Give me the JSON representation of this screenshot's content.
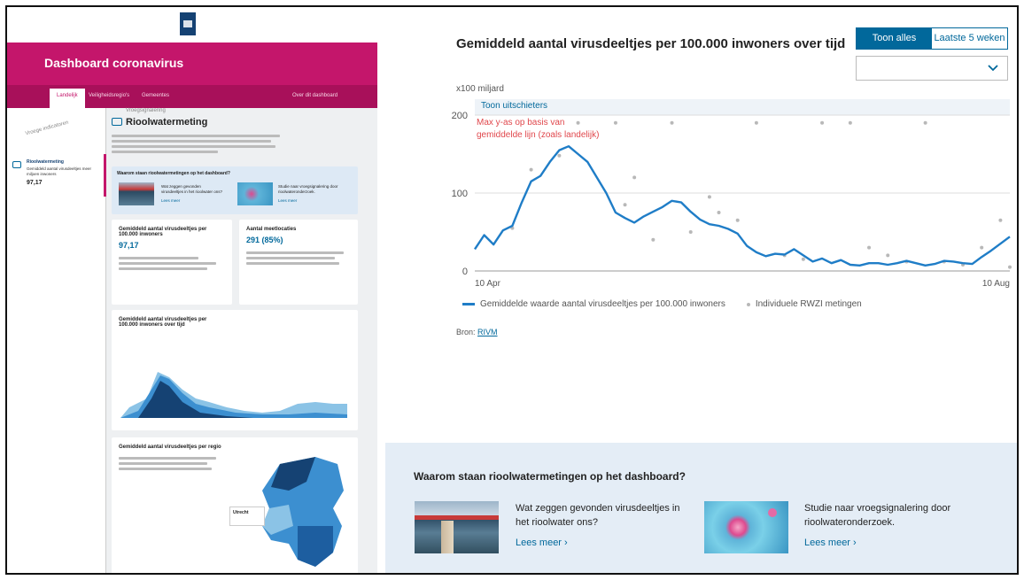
{
  "mini_dashboard": {
    "header_title": "Dashboard coronavirus",
    "nav": [
      "Landelijk",
      "Veiligheidsregio's",
      "Gemeentes",
      "Over dit dashboard"
    ],
    "sidebar_rotated_label": "Vroege indicatoren",
    "sidebar_item_title": "Rioolwatermeting",
    "sidebar_item_desc": "Gemiddeld aantal virusdeeltjes\nmeer miljoen inwoners",
    "sidebar_item_value": "97,17",
    "page_category": "Vroegsignalering",
    "page_title": "Rioolwatermeting",
    "cards": {
      "waarom": "Waarom staan rioolwatermetingen op het dashboard?",
      "waarom_q1": "Wat zeggen gevonden virusdeeltjes in het rioolwater ons?",
      "waarom_q2": "Studie naar vroegsignalering door rioolwateronderzoek.",
      "lees_meer": "Lees meer",
      "avg_title": "Gemiddeld aantal virusdeeltjes per 100.000 inwoners",
      "avg_value": "97,17",
      "loc_title": "Aantal meetlocaties",
      "loc_value": "291 (85%)",
      "chart_title": "Gemiddeld aantal virusdeeltjes per 100.000 inwoners over tijd",
      "map_title": "Gemiddeld aantal virusdeeltjes per regio",
      "map_tooltip_region": "Utrecht"
    }
  },
  "big_chart": {
    "title": "Gemiddeld aantal virusdeeltjes per 100.000 inwoners over tijd",
    "toggle_options": [
      "Toon alles",
      "Laatste 5 weken"
    ],
    "toggle_active": 0,
    "unit_label": "x100 miljard",
    "show_outliers_label": "Toon uitschieters",
    "note": "Max y-as op basis van gemiddelde lijn (zoals landelijk)",
    "source_label": "Bron:",
    "source_link": "RIVM",
    "legend": [
      "Gemiddelde waarde aantal virusdeeltjes per 100.000 inwoners",
      "Individuele RWZI metingen"
    ]
  },
  "chart_data": {
    "type": "line",
    "xlabel": "",
    "ylabel": "x100 miljard",
    "ylim": [
      0,
      200
    ],
    "yticks": [
      0,
      100,
      200
    ],
    "x_tick_labels": [
      "10 Apr",
      "10 Aug"
    ],
    "grid": true,
    "legend_position": "bottom",
    "colors": {
      "line": "#1f7dc7",
      "dots": "#b8b8b8"
    },
    "series": [
      {
        "name": "Gemiddelde waarde aantal virusdeeltjes per 100.000 inwoners",
        "values": [
          28,
          46,
          34,
          52,
          58,
          88,
          115,
          122,
          140,
          155,
          160,
          150,
          140,
          120,
          100,
          75,
          68,
          62,
          70,
          76,
          82,
          90,
          88,
          76,
          66,
          60,
          58,
          54,
          48,
          32,
          24,
          19,
          22,
          21,
          28,
          20,
          12,
          16,
          10,
          14,
          8,
          7,
          10,
          10,
          8,
          10,
          13,
          10,
          7,
          9,
          13,
          12,
          10,
          9,
          18,
          26,
          35,
          44
        ]
      },
      {
        "name": "Individuele RWZI metingen",
        "points": [
          [
            4,
            55
          ],
          [
            6,
            130
          ],
          [
            9,
            148
          ],
          [
            11,
            190
          ],
          [
            15,
            190
          ],
          [
            16,
            85
          ],
          [
            17,
            120
          ],
          [
            19,
            40
          ],
          [
            21,
            190
          ],
          [
            23,
            50
          ],
          [
            25,
            95
          ],
          [
            26,
            75
          ],
          [
            28,
            65
          ],
          [
            30,
            190
          ],
          [
            33,
            20
          ],
          [
            35,
            15
          ],
          [
            37,
            190
          ],
          [
            40,
            190
          ],
          [
            42,
            30
          ],
          [
            44,
            20
          ],
          [
            46,
            12
          ],
          [
            48,
            190
          ],
          [
            50,
            12
          ],
          [
            52,
            8
          ],
          [
            54,
            30
          ],
          [
            56,
            65
          ],
          [
            57,
            5
          ]
        ]
      }
    ]
  },
  "bottom_panel": {
    "title": "Waarom staan rioolwatermetingen op het dashboard?",
    "item1_text": "Wat zeggen gevonden virusdeeltjes in het rioolwater ons?",
    "item2_text": "Studie naar vroegsignalering door rioolwateronderzoek.",
    "lees_meer": "Lees meer"
  }
}
